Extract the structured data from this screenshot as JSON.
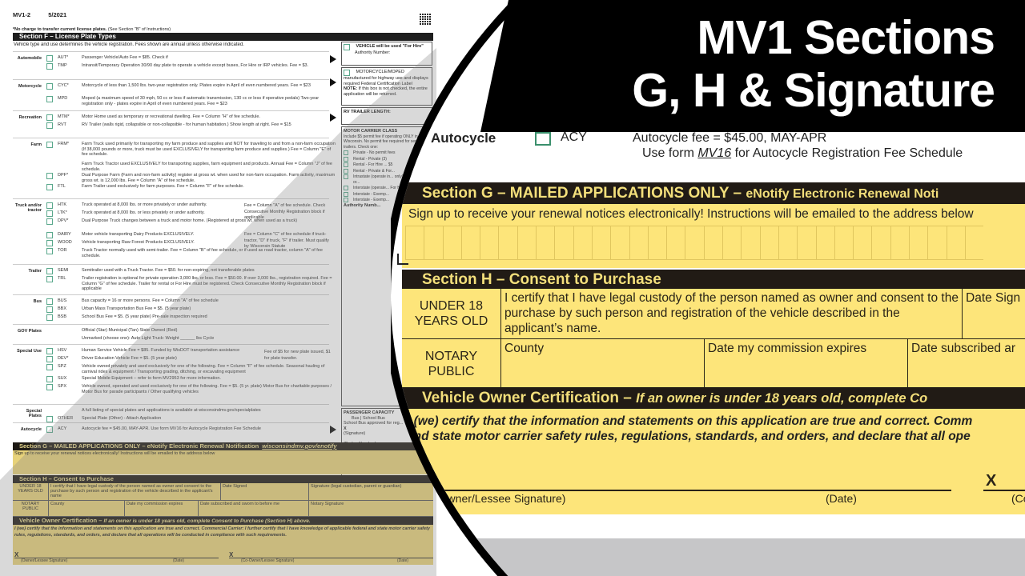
{
  "title": {
    "line1": "MV1 Sections",
    "line2": "G, H & Signature"
  },
  "small_form": {
    "form_id": "MV1-2",
    "form_date": "5/2021",
    "no_charge_note_bold": "*No charge to transfer current license plates.",
    "no_charge_note": "(See Section \"B\" of Instructions)",
    "section_f_title": "Section F – License Plate Types",
    "section_f_sub": "Vehicle type and use determines the vehicle registration. Fees shown are annual unless otherwise indicated.",
    "groups": [
      {
        "category": "Automobile",
        "items": [
          {
            "code": "AUT*",
            "desc": "Passenger Vehicle/Auto Fee = $85. Check if"
          },
          {
            "code": "TMP",
            "desc": "Intransit/Temporary Operation 30/90 day plate to operate a vehicle except buses, For Hire or IRP vehicles. Fee = $3."
          }
        ]
      },
      {
        "category": "Motorcycle",
        "items": [
          {
            "code": "CYC*",
            "desc": "Motorcycle of less than 1,500 lbs. two-year registration only. Plates expire in April of even numbered years. Fee = $23"
          },
          {
            "code": "MPD",
            "desc": "Moped (a maximum speed of 30 mph, 50 cc or less if automatic transmission, 130 cc or less if operative pedals) Two-year registration only - plates expire in April of even numbered years. Fee = $23"
          }
        ]
      },
      {
        "category": "Recreation",
        "items": [
          {
            "code": "MTM*",
            "desc": "Motor Home used as temporary or recreational dwelling. Fee = Column \"H\" of fee schedule."
          },
          {
            "code": "RVT",
            "desc": "RV Trailer (walls rigid, collapsible or non-collapsible - for human habitation.) Show length at right. Fee = $15"
          }
        ]
      },
      {
        "category": "Farm",
        "items": [
          {
            "code": "FRM*",
            "desc": "Farm Truck used primarily for transporting my farm produce and supplies and NOT for traveling to and from a non-farm occupation (If 38,000 pounds or more, truck must be used EXCLUSIVELY for transporting farm produce and supplies.) Fee = Column \"E\" of fee schedule."
          },
          {
            "code": "",
            "desc": "Farm Truck Tractor used EXCLUSIVELY for transporting supplies, farm equipment and products. Annual Fee = Column \"J\" of fee schedule."
          },
          {
            "code": "DPF*",
            "desc": "Dual Purpose Farm (Farm and non-farm activity) register at gross wt. when used for non-farm occupation. Farm activity, maximum gross wt. is 12,000 lbs. Fee = Column \"A\" of fee schedule."
          },
          {
            "code": "FTL",
            "desc": "Farm Trailer used exclusively for farm purposes. Fee = Column \"F\" of fee schedule."
          }
        ]
      },
      {
        "category": "Truck and/or tractor",
        "items": [
          {
            "code": "HTK",
            "desc": "Truck operated at 8,000 lbs. or more privately or under authority."
          },
          {
            "code": "LTK*",
            "desc": "Truck operated at 8,000 lbs. or less privately or under authority."
          },
          {
            "code": "DPV*",
            "desc": "Dual Purpose Truck changes between a truck and motor home. (Registered at gross wt. when used as a truck)"
          },
          {
            "code": "DAIRY",
            "desc": "Motor vehicle transporting Dairy Products EXCLUSIVELY."
          },
          {
            "code": "WOOD",
            "desc": "Vehicle transporting Raw Forest Products EXCLUSIVELY."
          },
          {
            "code": "TOR",
            "desc": "Truck Tractor normally used with semi-trailer. Fee = Column \"B\" of fee schedule, or if used as road tractor, column \"A\" of fee schedule."
          }
        ]
      },
      {
        "category": "Trailer",
        "items": [
          {
            "code": "SEMI",
            "desc": "Semitrailer used with a Truck Tractor. Fee = $50. for non-expiring, not transferable plates"
          },
          {
            "code": "TRL",
            "desc": "Trailer registration is optional for private operation 3,000 lbs. or less. Fee = $50.00. If over 3,000 lbs., registration required. Fee = Column \"G\" of fee schedule. Trailer for rental or For Hire must be registered. Check Consecutive Monthly Registration block if applicable"
          }
        ]
      },
      {
        "category": "Bus",
        "items": [
          {
            "code": "BUS",
            "desc": "Bus capacity = 16 or more persons. Fee = Column \"A\" of fee schedule"
          },
          {
            "code": "BBX",
            "desc": "Urban Mass Transportation Bus Fee = $5. (5 year plate)"
          },
          {
            "code": "BSB",
            "desc": "School Bus Fee = $5. (5 year plate) Pre-sale inspection required"
          }
        ]
      },
      {
        "category": "GOV Plates",
        "items": [
          {
            "code": "",
            "desc": "Official (Star)   Municipal (Tan)   State Owned (Red)"
          },
          {
            "code": "",
            "desc": "Unmarked (choose one): Auto  Light Truck: Weight ______ lbs  Cycle"
          }
        ]
      },
      {
        "category": "Special Use",
        "items": [
          {
            "code": "HSV",
            "desc": "Human Service Vehicle Fee = $85. Funded by WisDOT transportation assistance"
          },
          {
            "code": "DEV*",
            "desc": "Driver Education Vehicle Fee = $5. (5 year plate)"
          },
          {
            "code": "SPZ",
            "desc": "Vehicle owned privately and used exclusively for one of the following. Fee = Column \"F\" of fee schedule. Seasonal hauling of carnival rides & equipment / Transporting grading, ditching, or excavating equipment"
          },
          {
            "code": "SUX",
            "desc": "Special Mobile Equipment – refer to form MV2953 for more information."
          },
          {
            "code": "SPX",
            "desc": "Vehicle owned, operated and used exclusively for one of the following. Fee = $5. (5 yr. plate) Motor Bus for charitable purposes / Motor Bus for parade participants / Other qualifying vehicles"
          }
        ]
      },
      {
        "category": "Special Plates",
        "items": [
          {
            "code": "",
            "desc": "A full listing of special plates and applications is available at wisconsindmv.gov/specialplates"
          },
          {
            "code": "OTHER",
            "desc": "Special Plate (Other) - Attach Application"
          }
        ]
      },
      {
        "category": "Autocycle",
        "items": [
          {
            "code": "ACY",
            "desc": "Autocycle fee = $45.00, MAY-APR. Use form MV16 for Autocycle Registration Fee Schedule"
          }
        ]
      }
    ],
    "truck_note_a": "Fee = Column \"A\" of fee schedule. Check Consecutive Monthly Registration block if applicable",
    "truck_note_c": "Fee = Column \"C\" of fee schedule if truck-tractor, \"D\" if truck, \"F\" if trailer. Must qualify by Wisconsin Statute",
    "gov_note": "Fee of $5 for new plate issued, $1 for plate transfer.",
    "side": {
      "vehicle_for_hire": "VEHICLE will be used \"For Hire\"",
      "authority_number": "Authority Number:",
      "motorcycle_moped": "MOTORCYCLE/MOPED manufactured for highway use and displays required Federal Certification Label",
      "note_bold": "NOTE:",
      "note": "If this box is not checked, the entire application will be returned.",
      "rv_trailer_length": "RV TRAILER LENGTH:",
      "motor_carrier_class": "MOTOR CARRIER CLASS",
      "motor_carrier_desc": "Include $5 permit fee if operating ONLY in Wisconsin. No permit fee required for semi-trailers. Check one:",
      "carrier_options": [
        "Private - No permit fees",
        "Rental - Private (3)",
        "Rental - For Hire ... $5",
        "Rental - Private & For...",
        "Intrastate (operate in... only) For Hire, PC or...",
        "Interstate (operate... For Hire (9)",
        "Interstate - Exemp...",
        "Interstate - Exemp..."
      ],
      "authority_number_label": "Authority Numb...",
      "passenger_capacity": "PASSENGER CAPACITY",
      "bus": "Bus",
      "school_bus": "School Bus",
      "school_bus_approved": "School Bus approved for reg...",
      "signature": "(Signature)",
      "badge_number": "(Badge Number)"
    },
    "section_g_title": "Section G – MAILED APPLICATIONS ONLY – eNotify Electronic Renewal Notification",
    "section_g_link": "wisconsindmv.gov/enotify",
    "section_g_sub": "Sign up to receive your renewal notices electronically! Instructions will be emailed to the address below",
    "section_h_title": "Section H – Consent to Purchase",
    "under18": "UNDER 18 YEARS OLD",
    "under18_text": "I certify that I have legal custody of the person named as owner and consent to the purchase by such person and registration of the vehicle described in the applicant's name",
    "date_signed": "Date Signed",
    "sig_custodian": "Signature (legal custodian, parent or guardian)",
    "notary": "NOTARY PUBLIC",
    "county": "County",
    "commission": "Date my commission expires",
    "subscribed": "Date subscribed and sworn to before me",
    "notary_sig": "Notary Signature",
    "voc_title": "Vehicle Owner Certification –",
    "voc_italic": "If an owner is under 18 years old, complete Consent to Purchase (Section H) above.",
    "cert_text": "I (we) certify that the information and statements on this application are true and correct. Commercial Carrier: I further certify that I have knowledge of applicable federal and state motor carrier safety rules, regulations, standards, and orders, and declare that all operations will be conducted in compliance with such requirements.",
    "owner_sig": "(Owner/Lessee Signature)",
    "date": "(Date)",
    "coowner_sig": "(Co-Owner/Lessee Signature)",
    "x_mark": "X"
  },
  "zoom": {
    "acy_category": "Autocycle",
    "acy_code": "ACY",
    "acy_line1": "Autocycle fee = $45.00, MAY-APR",
    "acy_line2_pre": "Use form ",
    "acy_line2_link": "MV16",
    "acy_line2_post": " for Autocycle Registration Fee Schedule",
    "section_g_title": "Section G – MAILED APPLICATIONS ONLY –",
    "section_g_tail": "eNotify Electronic Renewal Noti",
    "section_g_sub": "Sign up to receive your renewal notices electronically! Instructions will be emailed to the address below",
    "email_box_count": 31,
    "section_h_title": "Section H – Consent to Purchase",
    "under18": "UNDER 18 YEARS OLD",
    "under18_text": "I certify that I have legal custody of the person named as owner and consent to the purchase by such person and registration of the vehicle described in the applicant’s name.",
    "date_signed": "Date Sign",
    "notary": "NOTARY PUBLIC",
    "county": "County",
    "commission": "Date my commission expires",
    "subscribed": "Date subscribed ar",
    "voc_title": "Vehicle Owner Certification –",
    "voc_italic": "If an owner is under 18 years old, complete Co",
    "cert_line1": "I (we) certify that the information and statements on this application are true and correct. Comm",
    "cert_line2": "and state motor carrier safety rules, regulations, standards, and orders, and declare that all ope",
    "owner_sig": "(Owner/Lessee Signature)",
    "date": "(Date)",
    "coowner_sig": "(Co",
    "x_mark": "X"
  }
}
